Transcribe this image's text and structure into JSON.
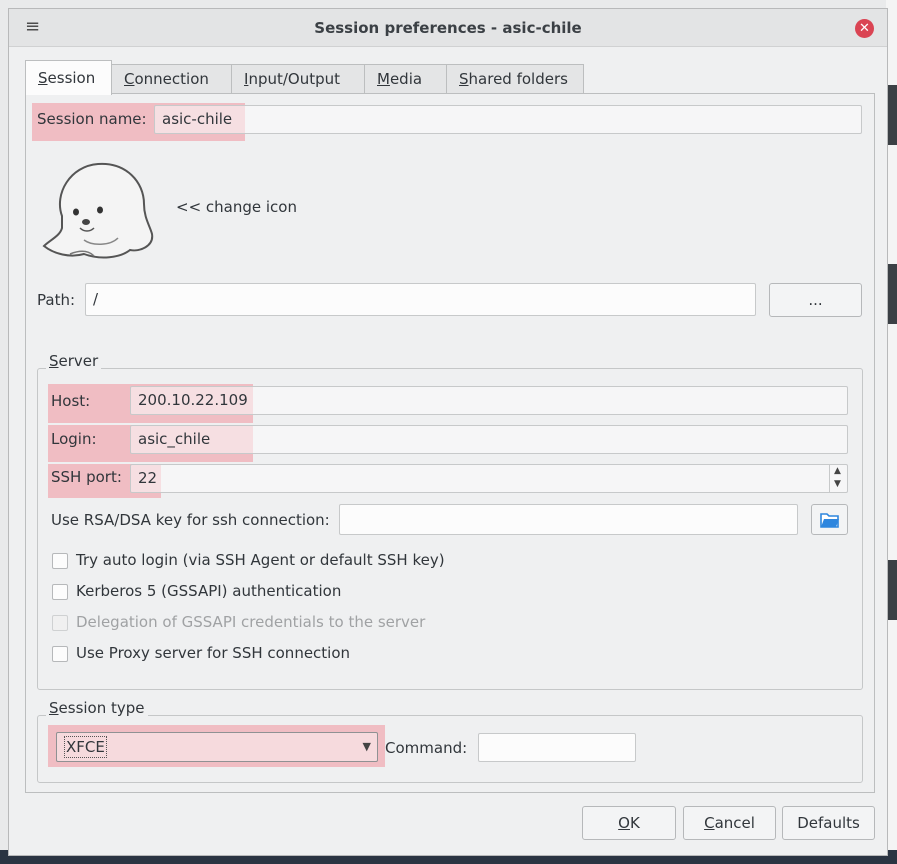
{
  "window": {
    "title": "Session preferences - asic-chile",
    "menu_glyph": "≡",
    "close_glyph": "✕"
  },
  "tabs": [
    {
      "first": "S",
      "rest": "ession"
    },
    {
      "first": "C",
      "rest": "onnection"
    },
    {
      "first": "I",
      "rest": "nput/Output"
    },
    {
      "first": "M",
      "rest": "edia"
    },
    {
      "first": "S",
      "rest": "hared folders"
    }
  ],
  "session": {
    "name_label": "Session name:",
    "name_value": "asic-chile",
    "change_icon_label": "<< change icon",
    "path_label": "Path:",
    "path_value": "/",
    "browse_label": "..."
  },
  "server": {
    "group_first": "S",
    "group_rest": "erver",
    "host_label": "Host:",
    "host_value": "200.10.22.109",
    "login_label": "Login:",
    "login_value": "asic_chile",
    "port_label": "SSH port:",
    "port_value": "22",
    "rsa_label": "Use RSA/DSA key for ssh connection:",
    "rsa_value": "",
    "options": [
      {
        "label": "Try auto login (via SSH Agent or default SSH key)",
        "checked": false,
        "enabled": true
      },
      {
        "label": "Kerberos 5 (GSSAPI) authentication",
        "checked": false,
        "enabled": true
      },
      {
        "label": "Delegation of GSSAPI credentials to the server",
        "checked": false,
        "enabled": false
      },
      {
        "label": "Use Proxy server for SSH connection",
        "checked": false,
        "enabled": true
      }
    ]
  },
  "session_type": {
    "group_first": "S",
    "group_rest": "ession type",
    "type_value": "XFCE",
    "command_label": "Command:",
    "command_value": ""
  },
  "buttons": {
    "ok_first": "O",
    "ok_rest": "K",
    "cancel_first": "C",
    "cancel_rest": "ancel",
    "defaults": "Defaults"
  },
  "colors": {
    "highlight": "#f0a0a8",
    "close_red": "#da4453",
    "folder_blue": "#2e86de"
  }
}
